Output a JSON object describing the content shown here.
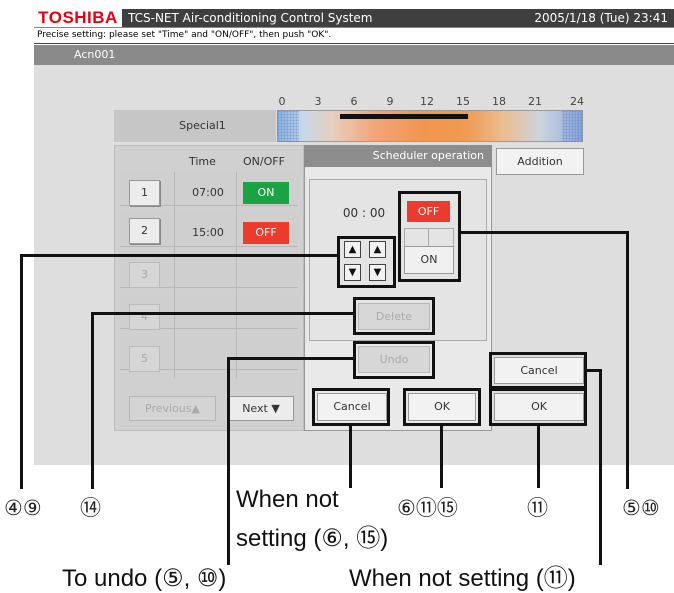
{
  "header": {
    "logo": "TOSHIBA",
    "app_title": "TCS-NET Air-conditioning Control System",
    "datetime": "2005/1/18 (Tue)  23:41"
  },
  "message": "Precise setting: please set \"Time\" and \"ON/OFF\", then push \"OK\".",
  "unit_name": "Acn001",
  "timeline": {
    "label": "Special1",
    "ticks": [
      "0",
      "3",
      "6",
      "9",
      "12",
      "15",
      "18",
      "21",
      "24"
    ]
  },
  "schedule_list": {
    "col_time": "Time",
    "col_onoff": "ON/OFF",
    "rows": [
      {
        "num": "1",
        "time": "07:00",
        "state": "ON"
      },
      {
        "num": "2",
        "time": "15:00",
        "state": "OFF"
      },
      {
        "num": "3",
        "time": "",
        "state": ""
      },
      {
        "num": "4",
        "time": "",
        "state": ""
      },
      {
        "num": "5",
        "time": "",
        "state": ""
      }
    ],
    "previous_label": "Previous▲",
    "next_label": "Next ▼"
  },
  "scheduler": {
    "title": "Scheduler operation",
    "time_value": "00 : 00",
    "off_label": "OFF",
    "on_label": "ON",
    "up_arrow": "▲",
    "down_arrow": "▼",
    "delete_label": "Delete",
    "undo_label": "Undo",
    "cancel_label": "Cancel",
    "ok_label": "OK"
  },
  "right_buttons": {
    "addition_label": "Addition",
    "cancel_label": "Cancel",
    "ok_label": "OK"
  },
  "colors": {
    "on_green": "#1aa343",
    "off_red": "#ec3a2e",
    "toshiba_red": "#e60012"
  },
  "callouts": {
    "c_4_9": "④⑨",
    "c_14": "⑭",
    "c_6_11_15": "⑥⑪⑮",
    "c_11": "⑪",
    "c_5_10": "⑤⑩"
  },
  "captions": {
    "when_not_setting_1_line1": "When not",
    "when_not_setting_1_line2": "setting (⑥, ⑮)",
    "to_undo": "To undo (⑤, ⑩)",
    "when_not_setting_2": "When not setting (⑪)"
  }
}
